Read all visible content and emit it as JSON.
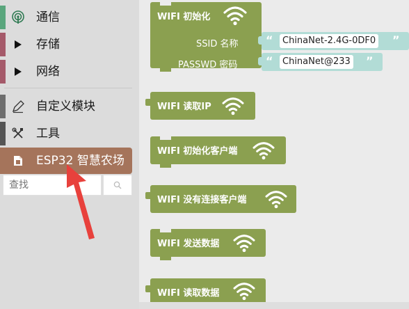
{
  "sidebar": {
    "categories": [
      {
        "label": "通信",
        "icon": "antenna-icon",
        "color": "#5aa67d"
      },
      {
        "label": "存储",
        "icon": "play-icon",
        "color": "#a55a6a"
      },
      {
        "label": "网络",
        "icon": "play-icon",
        "color": "#a55a6a"
      },
      {
        "label": "自定义模块",
        "icon": "pen-icon",
        "color": "#6e6e6e"
      },
      {
        "label": "工具",
        "icon": "tools-icon",
        "color": "#555555"
      },
      {
        "label": "ESP32 智慧农场",
        "icon": "farm-icon",
        "color": "#a5745b"
      }
    ],
    "search": {
      "placeholder": "查找",
      "button_icon": "search-icon"
    }
  },
  "blocks": [
    {
      "title": "WIFI 初始化",
      "ssid_label": "SSID  名称",
      "ssid_value": "ChinaNet-2.4G-0DF0",
      "passwd_label": "PASSWD  密码",
      "passwd_value": "ChinaNet@233"
    },
    {
      "title": "WIFI 读取IP"
    },
    {
      "title": "WIFI 初始化客户端"
    },
    {
      "title": "WIFI 没有连接客户端"
    },
    {
      "title": "WIFI 发送数据"
    },
    {
      "title": "WIFI 读取数据"
    }
  ],
  "quote_open": "“",
  "quote_close": "”",
  "colors": {
    "block_green": "#8ba050",
    "string_teal": "#b2dcd6",
    "selected_category": "#a5745b",
    "arrow_red": "#e8413c"
  }
}
